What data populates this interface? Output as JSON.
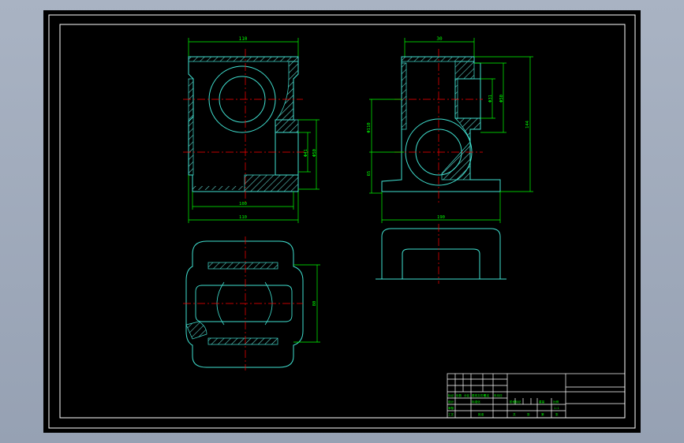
{
  "colors": {
    "window_bg": "#9ba6b8",
    "canvas": "#000000",
    "border": "#ffffff",
    "outline": "#40e0d0",
    "dimension": "#00ff00",
    "centerline": "#ff0000",
    "hatch": "#5fd0c8"
  },
  "dimensions": {
    "front_top_width": "110",
    "front_bottom_inner": "100",
    "front_bottom_total": "110",
    "front_bore_small": "Φ41",
    "front_bore_large": "Φ50",
    "side_top_width": "30",
    "side_bore_small": "Φ31",
    "side_bore_large": "Φ50",
    "side_total_height": "144",
    "side_left_upper": "Φ110",
    "side_left_lower": "65",
    "side_base_width": "190",
    "plan_height": "80"
  },
  "title_block": {
    "cells": [
      "标记",
      "处数",
      "分区",
      "更改文件号",
      "签名",
      "年月日",
      "设计",
      "标准化",
      "阶段标记",
      "重量",
      "比例",
      "审核",
      "工艺",
      "批准",
      "共",
      "张",
      "第",
      "张",
      "1:1"
    ]
  }
}
